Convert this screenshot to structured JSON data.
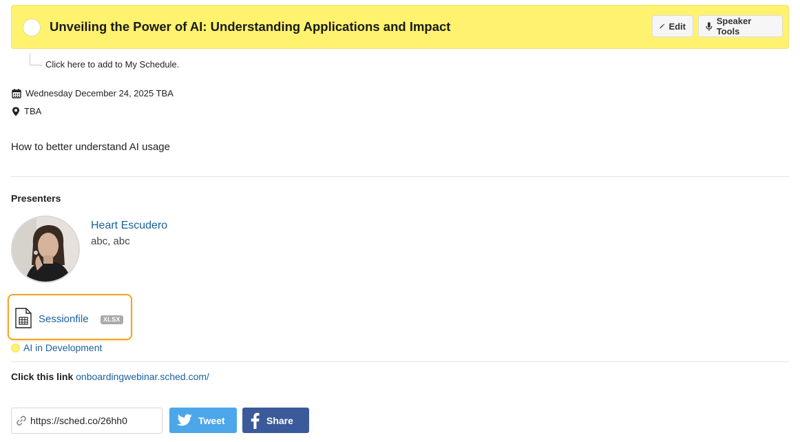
{
  "header": {
    "title": "Unveiling the Power of AI: Understanding Applications and Impact",
    "edit_label": "Edit",
    "speaker_tools_label": "Speaker Tools",
    "background_color": "#fff26e"
  },
  "schedule": {
    "add_label": "Click here to add to My Schedule."
  },
  "meta": {
    "date": "Wednesday December 24, 2025 TBA",
    "location": "TBA"
  },
  "description": "How to better understand AI usage",
  "presenters": {
    "heading": "Presenters",
    "items": [
      {
        "name": "Heart Escudero",
        "role": "abc, abc"
      }
    ]
  },
  "file": {
    "name": "Sessionfile",
    "type": "XLSX",
    "highlight_color": "#f0a623"
  },
  "tag": {
    "label": "AI in Development",
    "color": "#fff26e"
  },
  "link": {
    "label": "Click this link",
    "url": "onboardingwebinar.sched.com/"
  },
  "share": {
    "short_url": "https://sched.co/26hh0",
    "tweet_label": "Tweet",
    "share_label": "Share",
    "tweet_color": "#4ca6ea",
    "share_color": "#3b5a9a"
  }
}
